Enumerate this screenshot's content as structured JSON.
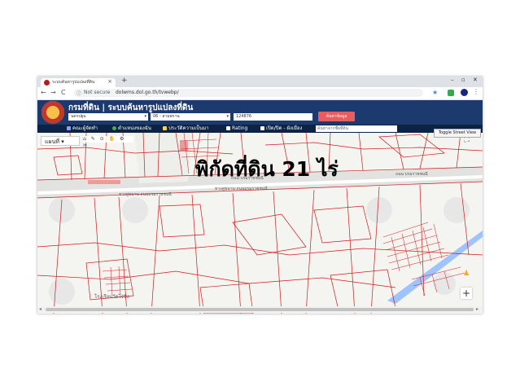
{
  "browser": {
    "tab_title": "ระบบค้นหารูปแปลงที่ดิน",
    "tab_close": "×",
    "new_tab": "+",
    "window_controls": [
      "–",
      "▫",
      "✕"
    ],
    "nav": {
      "back": "←",
      "forward": "→",
      "reload": "C"
    },
    "security_text": "Not secure",
    "url": "dolwms.dol.go.th/tvwebp/",
    "star": "★",
    "kebab": "⋮"
  },
  "site": {
    "title": "กรมที่ดิน | ระบบค้นหารูปแปลงที่ดิน",
    "province_select": "นครปฐม",
    "district_select": "06 - สามพราน",
    "parcel_input": "124876",
    "search_button": "ค้นหาข้อมูล"
  },
  "menu": {
    "items": [
      {
        "label": "คณะผู้จัดทำ",
        "color": "#8e9cf5"
      },
      {
        "label": "ตำแหน่งของฉัน",
        "color": "#4caf50"
      },
      {
        "label": "ประวัติความเป็นมา",
        "color": "#ffd54f"
      },
      {
        "label": "Rating",
        "color": "#ffffff"
      },
      {
        "label": "เปิด/ปิด - ผังเมือง",
        "color": "#ffffff"
      }
    ],
    "search_placeholder": "ค้นหาจากชื่อที่ดิน"
  },
  "map": {
    "toggle_street_view": "Toggle Street View",
    "map_type": "แผนที่",
    "map_type_arrow": "▾",
    "tools": "⌂ ✎ ⊙ ✋ ⚙ ✂",
    "overlay_text": "พิกัดที่ดิน 21 ไร่",
    "roads": [
      "ถนน บรมราชชนนี",
      "ถนน บรมราชชนนี",
      "ทางคู่ขนาน ถนนบรมราชชนนี",
      "ทางคู่ขนาน ถนนบรมราชชนนี"
    ],
    "bottom_label": "โรงเรียนวัดไร่ขิง",
    "fullscreen": "⛶",
    "pegman": "♟",
    "zoom_in": "+"
  },
  "colors": {
    "header": "#1c3a6e",
    "menubar": "#0c2346",
    "button": "#e85d5d",
    "parcel_lines": "#d11a1a"
  }
}
